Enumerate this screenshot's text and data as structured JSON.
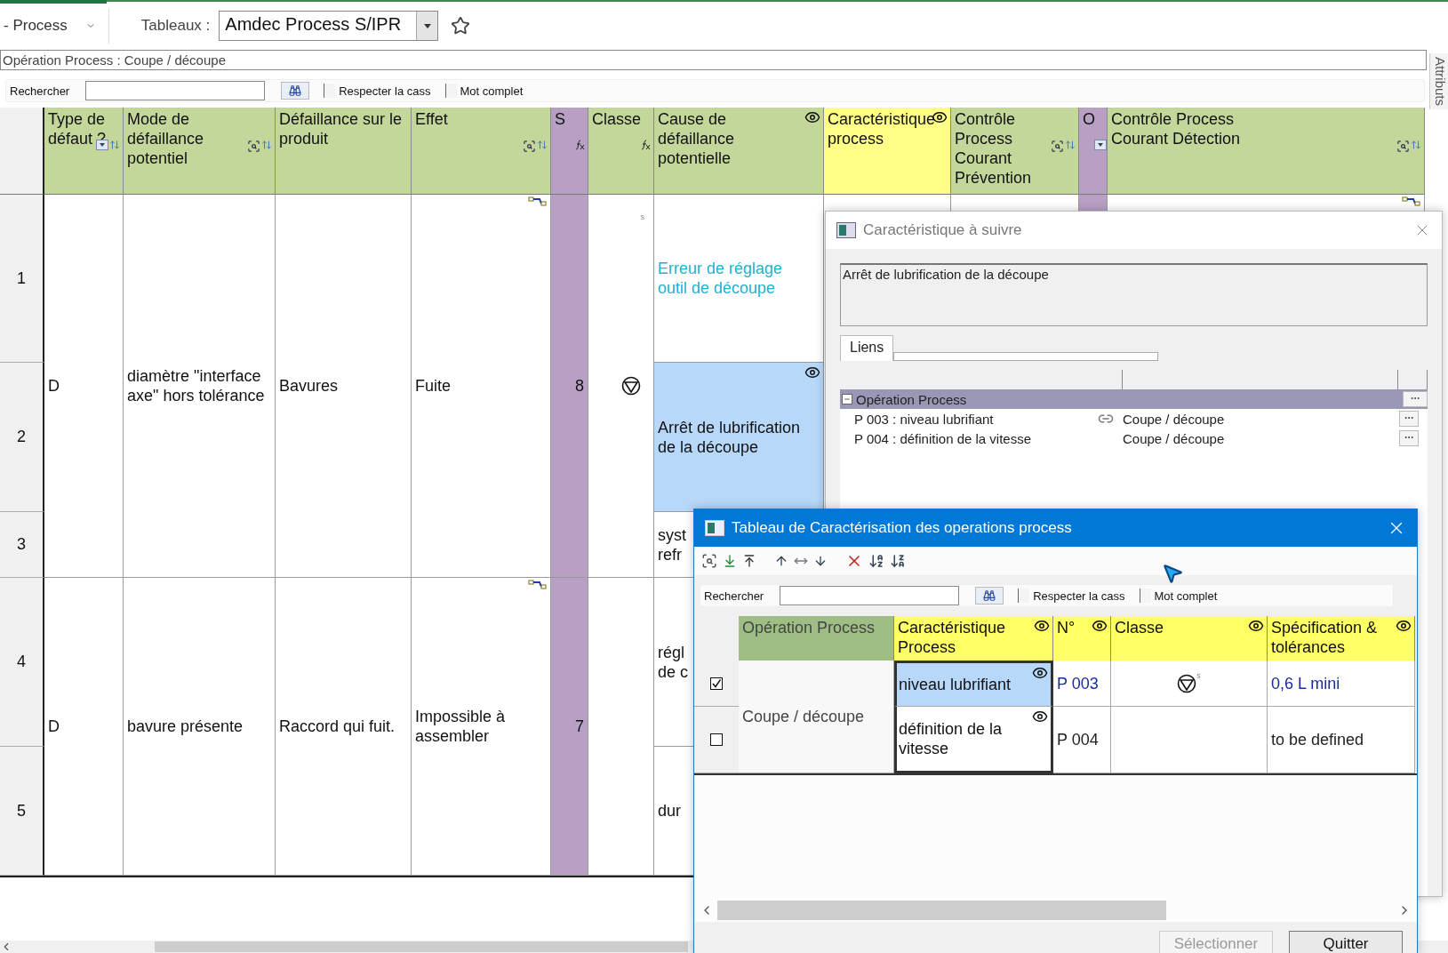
{
  "toolbar": {
    "view_menu": "- Process",
    "tableaux_label": "Tableaux :",
    "tableaux_value": "Amdec Process S/IPR"
  },
  "breadcrumb": "Opération Process : Coupe / découpe",
  "search": {
    "label": "Rechercher",
    "options": [
      {
        "label": "Respecter la cass",
        "checked": false
      },
      {
        "label": "Mot complet",
        "checked": false
      }
    ]
  },
  "side_tab": "Attributs",
  "table": {
    "columns": [
      {
        "label": "Type de défaut ?",
        "kind": "plain"
      },
      {
        "label": "Mode de défaillance potentiel",
        "kind": "plain"
      },
      {
        "label": "Défaillance sur le produit",
        "kind": "plain"
      },
      {
        "label": "Effet",
        "kind": "plain"
      },
      {
        "label": "S",
        "kind": "score"
      },
      {
        "label": "Classe",
        "kind": "plain"
      },
      {
        "label": "Cause de défaillance potentielle",
        "kind": "plain"
      },
      {
        "label": "Caractéristique process",
        "kind": "key"
      },
      {
        "label": "Contrôle Process Courant Prévention",
        "kind": "plain"
      },
      {
        "label": "O",
        "kind": "score"
      },
      {
        "label": "Contrôle Process Courant Détection",
        "kind": "plain"
      }
    ],
    "groups": [
      {
        "type": "D",
        "mode": "diamètre \"interface axe\" hors tolérance",
        "defaillance": "Bavures",
        "effet": "Fuite",
        "s": "8",
        "classe_mark": "s",
        "rows": [
          {
            "number": "1",
            "cause": "Erreur de réglage outil de découpe",
            "kind": "highlight",
            "selected": false
          },
          {
            "number": "2",
            "cause": "Arrêt de lubrification de la découpe",
            "kind": "plain",
            "selected": true
          },
          {
            "number": "3",
            "cause": "syst\nrefr",
            "kind": "plain",
            "selected": false
          }
        ]
      },
      {
        "type": "D",
        "mode": "bavure présente",
        "defaillance": "Raccord qui fuit.",
        "effet": "Impossible à assembler",
        "s": "7",
        "rows": [
          {
            "number": "4",
            "cause": "régl\nde c",
            "kind": "plain",
            "selected": false
          },
          {
            "number": "5",
            "cause": "dur",
            "kind": "plain",
            "selected": false
          }
        ]
      }
    ]
  },
  "dialog_suivre": {
    "title": "Caractéristique à suivre",
    "text": "Arrêt de lubrification de la découpe",
    "tabs": [
      {
        "label": "Liens",
        "selected": true
      }
    ],
    "tree": [
      {
        "label": "Opération Process",
        "expanded": true,
        "children": [
          {
            "label": "P 003 : niveau lubrifiant",
            "linked": true,
            "operation": "Coupe / découpe"
          },
          {
            "label": "P 004 : définition de la vitesse",
            "linked": false,
            "operation": "Coupe / découpe"
          }
        ]
      }
    ]
  },
  "dialog_tableau": {
    "title": "Tableau de Caractérisation des operations process",
    "search": {
      "label": "Rechercher",
      "options": [
        {
          "label": "Respecter la cass",
          "checked": false
        },
        {
          "label": "Mot complet",
          "checked": false
        }
      ]
    },
    "columns": [
      {
        "label": "Opération Process",
        "kind": "group"
      },
      {
        "label": "Caractéristique Process",
        "kind": "key"
      },
      {
        "label": "N°",
        "kind": "key"
      },
      {
        "label": "Classe",
        "kind": "key"
      },
      {
        "label": "Spécification & tolérances",
        "kind": "key"
      }
    ],
    "operation": "Coupe / découpe",
    "rows": [
      {
        "checked": true,
        "caracteristique": "niveau lubrifiant",
        "selected": true,
        "numero": "P 003",
        "classe_mark": "s",
        "specification": "0,6 L mini",
        "linked": true
      },
      {
        "checked": false,
        "caracteristique": "définition de la vitesse",
        "selected": false,
        "numero": "P 004",
        "specification": "to be defined",
        "linked": false
      }
    ],
    "buttons": [
      {
        "label": "Sélectionner",
        "disabled": true
      },
      {
        "label": "Quitter",
        "disabled": false
      }
    ]
  }
}
